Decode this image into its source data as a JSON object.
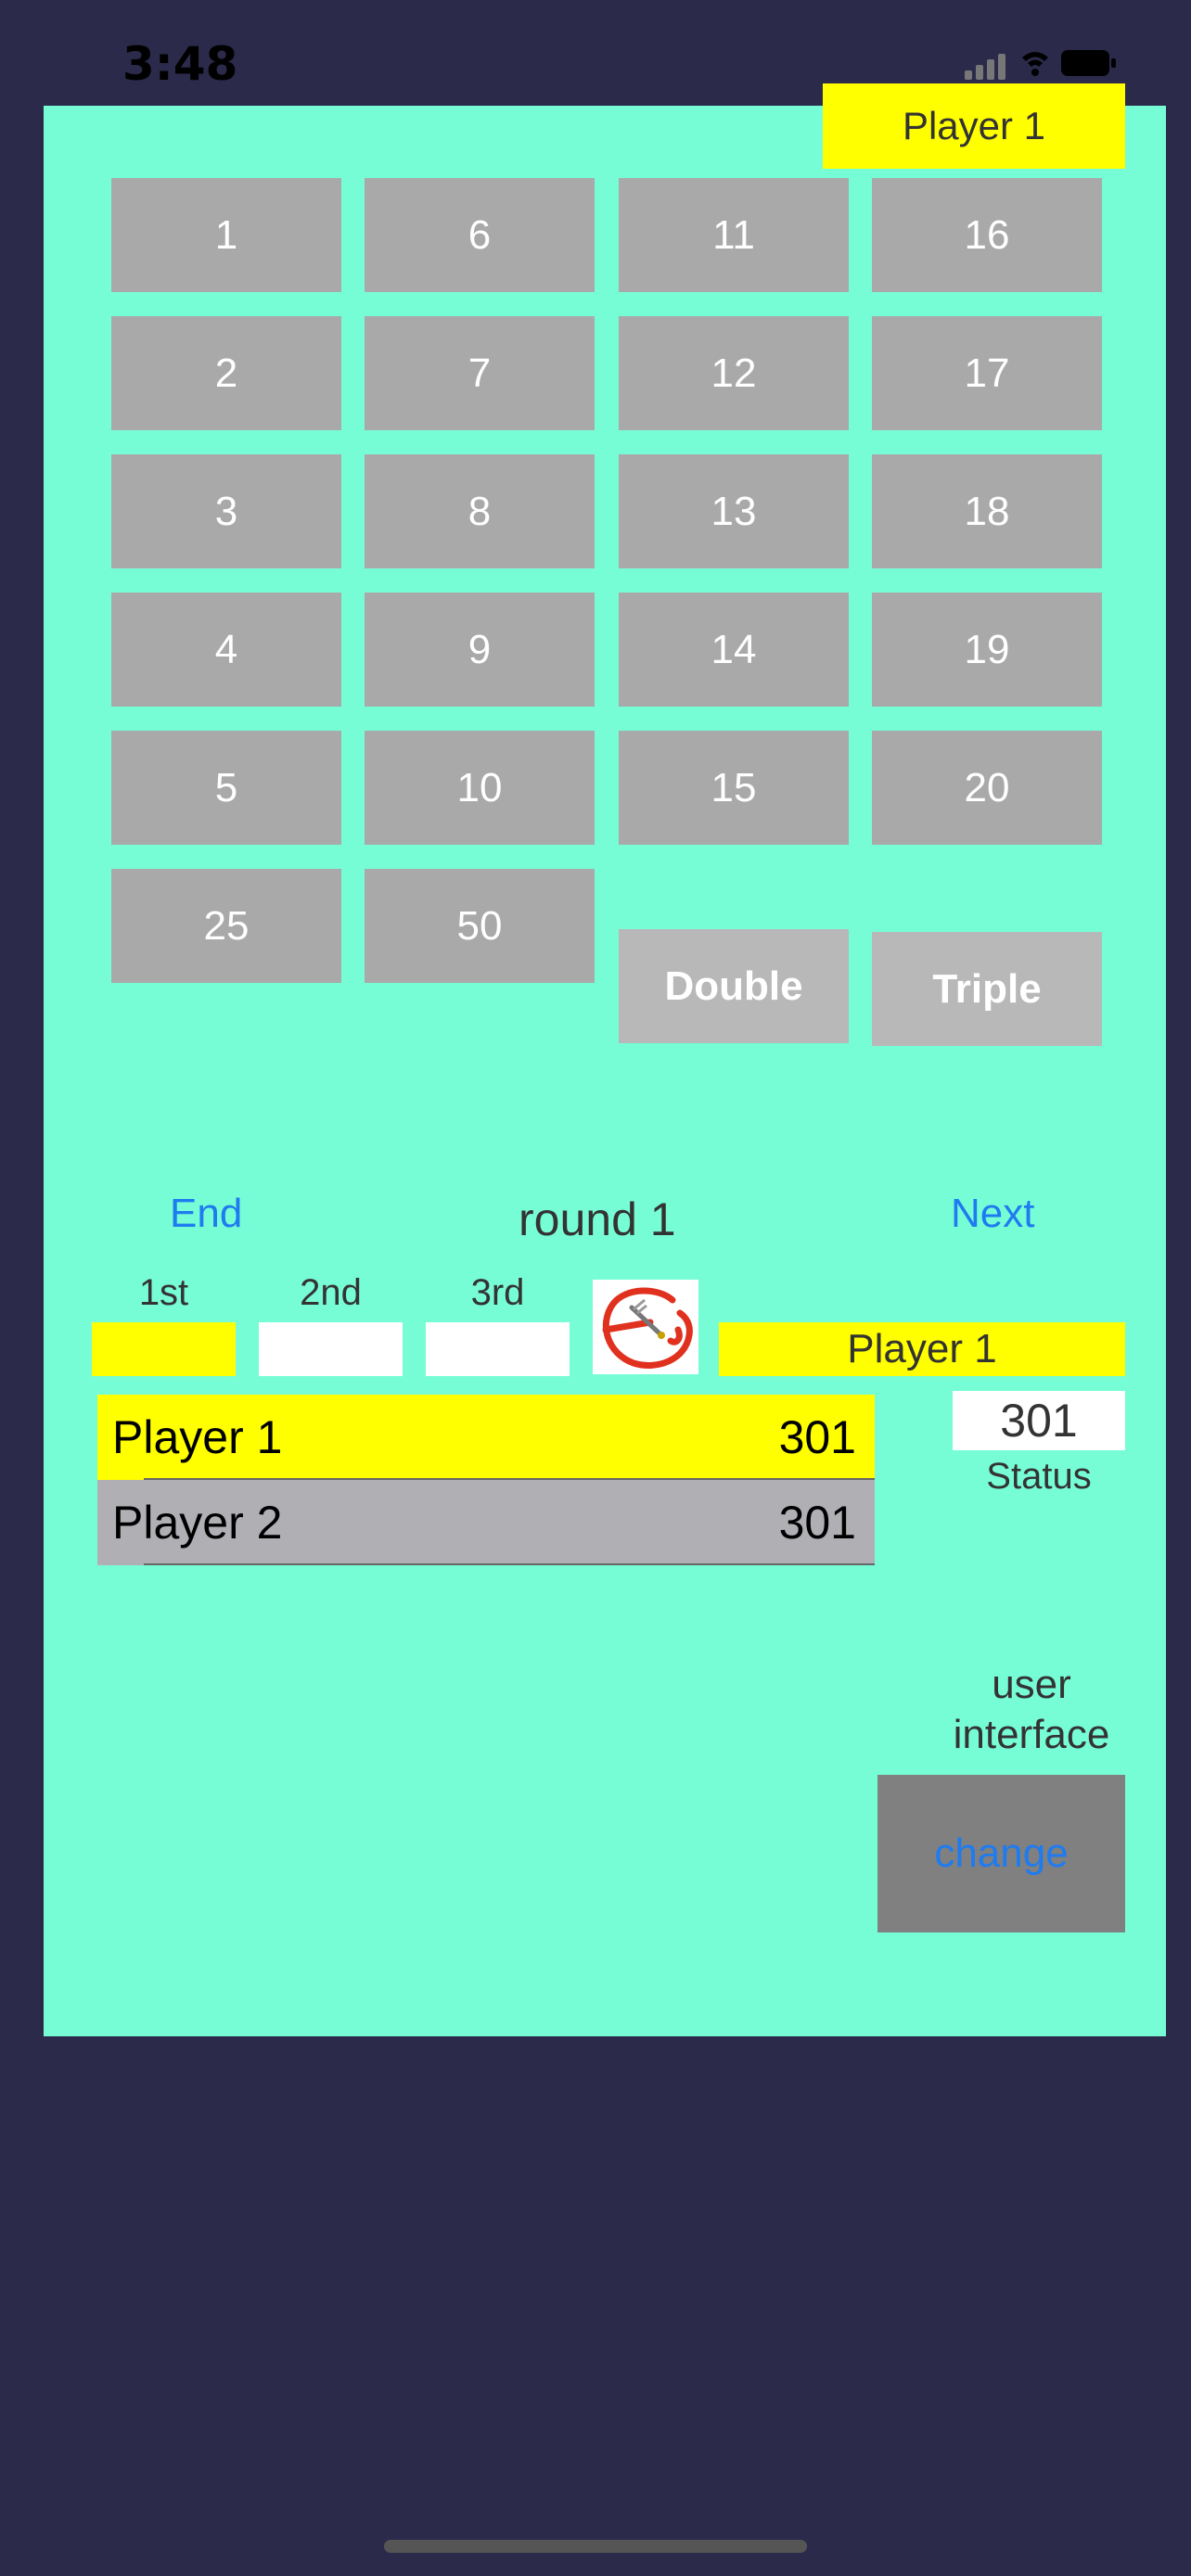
{
  "status_bar": {
    "time": "3:48"
  },
  "header": {
    "current_player": "Player 1"
  },
  "numbers": [
    "1",
    "2",
    "3",
    "4",
    "5",
    "6",
    "7",
    "8",
    "9",
    "10",
    "11",
    "12",
    "13",
    "14",
    "15",
    "16",
    "17",
    "18",
    "19",
    "20",
    "25",
    "50"
  ],
  "modifiers": {
    "double": "Double",
    "triple": "Triple"
  },
  "controls": {
    "end": "End",
    "round": "round 1",
    "next": "Next"
  },
  "darts": {
    "first": "1st",
    "second": "2nd",
    "third": "3rd"
  },
  "current_player_label": "Player 1",
  "scoreboard": [
    {
      "name": "Player 1",
      "score": "301",
      "color": "#ffff00"
    },
    {
      "name": "Player 2",
      "score": "301",
      "color": "#b0afb4"
    }
  ],
  "status": {
    "value": "301",
    "label": "Status"
  },
  "ui": {
    "line1": "user",
    "line2": "interface",
    "change": "change"
  },
  "colors": {
    "panel": "#77fdd6",
    "background": "#2b2a4a",
    "highlight": "#ffff00",
    "button": "#a9a9a9",
    "link": "#1e7bf0"
  }
}
